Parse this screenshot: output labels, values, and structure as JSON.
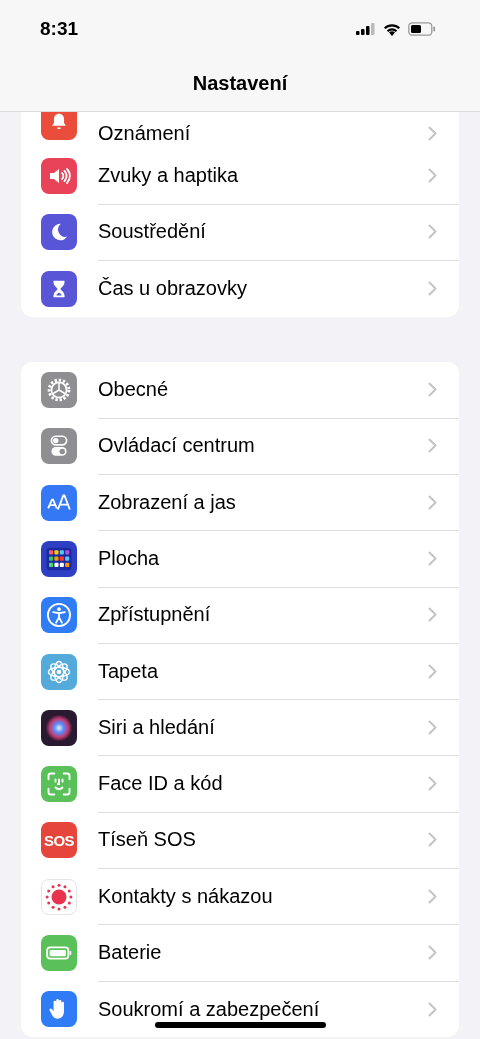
{
  "status_bar": {
    "time": "8:31"
  },
  "title": "Nastavení",
  "groups": [
    {
      "items": [
        {
          "label": "Oznámení"
        },
        {
          "label": "Zvuky a haptika"
        },
        {
          "label": "Soustředění"
        },
        {
          "label": "Čas u obrazovky"
        }
      ]
    },
    {
      "items": [
        {
          "label": "Obecné"
        },
        {
          "label": "Ovládací centrum"
        },
        {
          "label": "Zobrazení a jas"
        },
        {
          "label": "Plocha"
        },
        {
          "label": "Zpřístupnění"
        },
        {
          "label": "Tapeta"
        },
        {
          "label": "Siri a hledání"
        },
        {
          "label": "Face ID a kód"
        },
        {
          "label": "Tíseň SOS"
        },
        {
          "label": "Kontakty s nákazou"
        },
        {
          "label": "Baterie"
        },
        {
          "label": "Soukromí a zabezpečení"
        }
      ]
    }
  ],
  "sos_icon_text": "SOS"
}
